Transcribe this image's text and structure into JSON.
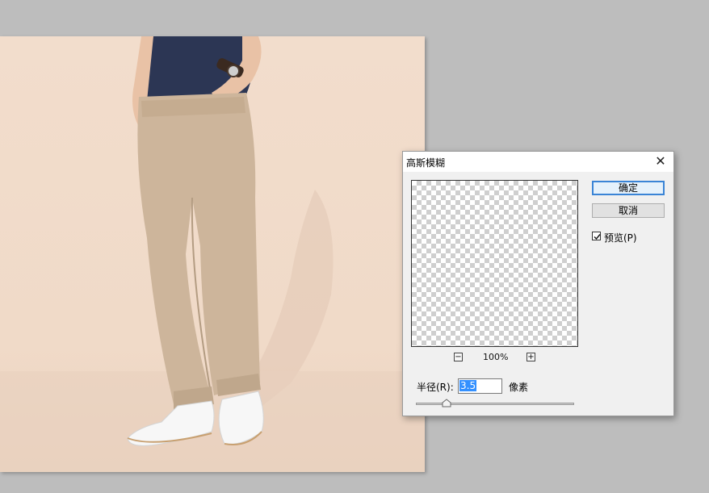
{
  "dialog": {
    "title": "高斯模糊",
    "close_glyph": "✕",
    "ok_label": "确定",
    "cancel_label": "取消",
    "preview_label": "预览(P)",
    "preview_checked": true,
    "zoom": {
      "minus": "−",
      "plus": "+",
      "value": "100%"
    },
    "radius": {
      "label": "半径(R):",
      "value": "3.5",
      "unit": "像素",
      "slider_fraction": 0.19
    }
  },
  "colors": {
    "workspace": "#bdbdbd",
    "canvas_bg": "#f2ddcc",
    "dialog_bg": "#f0f0f0",
    "accent": "#3a84d6"
  },
  "icons": [
    "close-icon",
    "zoom-out-icon",
    "zoom-in-icon",
    "checkmark-icon",
    "slider-thumb-icon"
  ]
}
